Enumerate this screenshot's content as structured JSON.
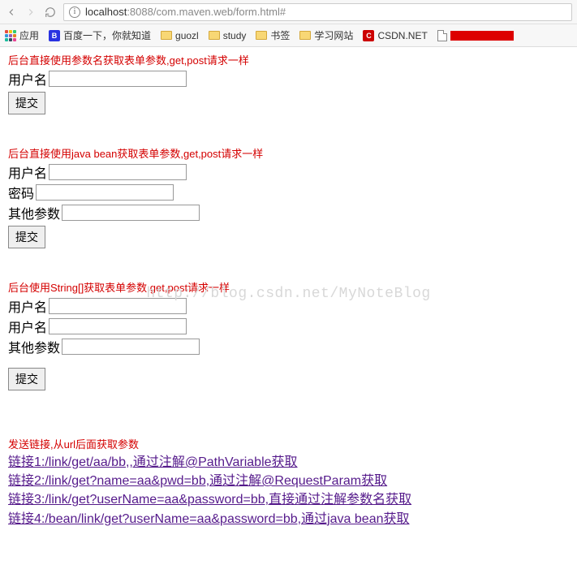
{
  "browser": {
    "url_host": "localhost",
    "url_port": ":8088",
    "url_path": "/com.maven.web/form.html#"
  },
  "bookmarks": {
    "apps": "应用",
    "baidu": "百度一下，你就知道",
    "guozl": "guozl",
    "study": "study",
    "shuqian": "书签",
    "xuexi": "学习网站",
    "csdn": "CSDN.NET"
  },
  "watermark": "http://blog.csdn.net/MyNoteBlog",
  "section1": {
    "title": "后台直接使用参数名获取表单参数,get,post请求一样",
    "label_user": "用户名",
    "submit": "提交"
  },
  "section2": {
    "title": "后台直接使用java bean获取表单参数,get,post请求一样",
    "label_user": "用户名",
    "label_pwd": "密码",
    "label_other": "其他参数",
    "submit": "提交"
  },
  "section3": {
    "title": "后台使用String[]获取表单参数,get,post请求一样",
    "label_user1": "用户名",
    "label_user2": "用户名",
    "label_other": "其他参数",
    "submit": "提交"
  },
  "section4": {
    "title": "发送链接,从url后面获取参数",
    "link1": "链接1:/link/get/aa/bb,,通过注解@PathVariable获取",
    "link2": "链接2:/link/get?name=aa&pwd=bb,通过注解@RequestParam获取",
    "link3": "链接3:/link/get?userName=aa&password=bb,直接通过注解参数名获取",
    "link4": "链接4:/bean/link/get?userName=aa&password=bb,通过java bean获取"
  }
}
